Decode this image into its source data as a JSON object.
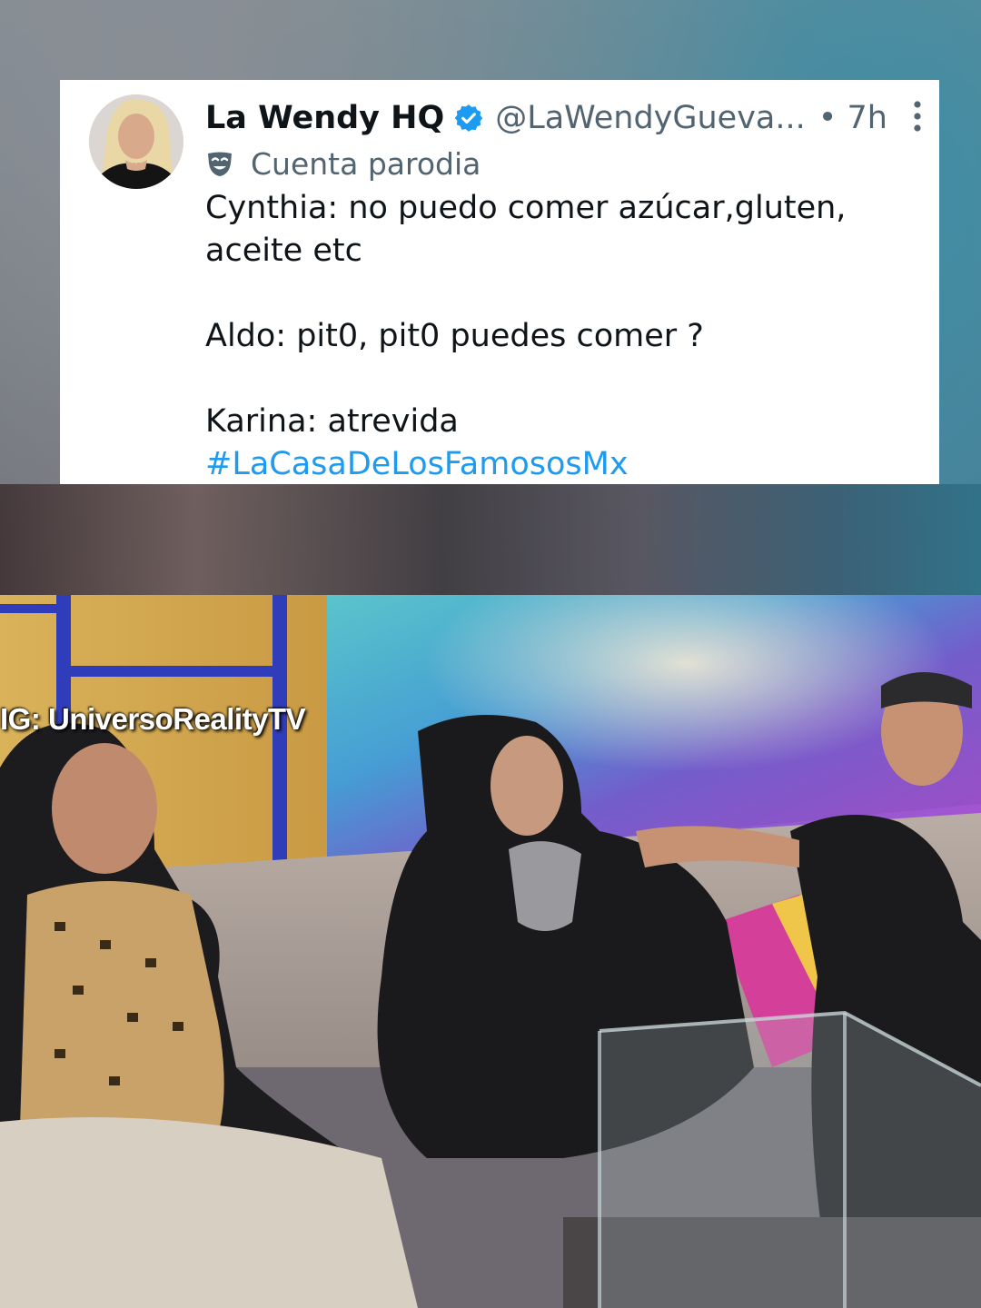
{
  "tweet": {
    "display_name": "La Wendy HQ",
    "handle": "@LaWendyGueva...",
    "time": "• 7h",
    "parody_label": "Cuenta parodia",
    "lines": [
      "Cynthia: no puedo comer azúcar,gluten,",
      "aceite etc",
      "Aldo: pit0, pit0 puedes comer ?",
      "Karina: atrevida"
    ],
    "hashtag": "#LaCasaDeLosFamososMx",
    "icons": {
      "verified": "verified-badge-icon",
      "parody": "parody-mask-icon",
      "more": "more-options-icon"
    },
    "colors": {
      "verified": "#1d9bf0",
      "hashtag": "#1d9bf0",
      "secondary_text": "#536471"
    }
  },
  "video": {
    "watermark": "IG: UniversoRealityTV"
  }
}
